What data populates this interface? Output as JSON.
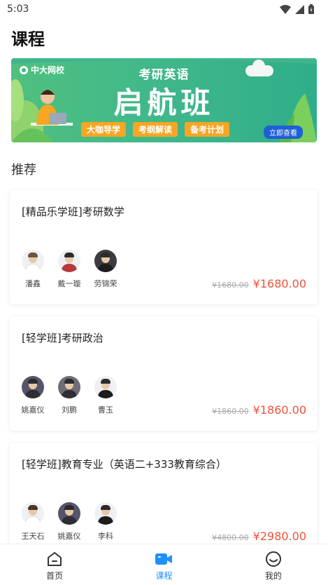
{
  "status": {
    "time": "5:03",
    "icons": [
      "wifi-icon",
      "signal-icon",
      "battery-icon"
    ]
  },
  "page": {
    "title": "课程"
  },
  "banner": {
    "logo": "中大网校",
    "subtitle": "考研英语",
    "title": "启航班",
    "tags": [
      "大咖导学",
      "考纲解读",
      "备考计划"
    ],
    "cta": "立即查看"
  },
  "section": {
    "title": "推荐"
  },
  "courses": [
    {
      "title": "[精品乐学班]考研数学",
      "teachers": [
        "潘鑫",
        "戴一璇",
        "劳锦荣"
      ],
      "original_price": "¥1680.00",
      "price": "¥1680.00"
    },
    {
      "title": "[轻学班]考研政治",
      "teachers": [
        "姚嘉仪",
        "刘鹏",
        "曹玉"
      ],
      "original_price": "¥1860.00",
      "price": "¥1860.00"
    },
    {
      "title": "[轻学班]教育专业（英语二+333教育综合）",
      "teachers": [
        "王天石",
        "姚嘉仪",
        "李科"
      ],
      "original_price": "¥4800.00",
      "price": "¥2980.00"
    }
  ],
  "tabs": [
    {
      "label": "首页",
      "icon": "home-icon",
      "active": false
    },
    {
      "label": "课程",
      "icon": "video-icon",
      "active": true
    },
    {
      "label": "我的",
      "icon": "smile-icon",
      "active": false
    }
  ],
  "colors": {
    "accent": "#1e90ff",
    "price": "#f0523a",
    "banner": "#43b98a"
  }
}
